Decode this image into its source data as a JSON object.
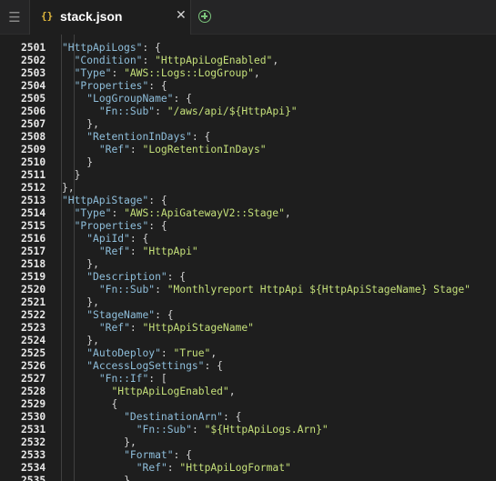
{
  "tab": {
    "icon": "{}",
    "title": "stack.json"
  },
  "lines": [
    {
      "n": "2501",
      "t": "    \"HttpApiLogs\": {"
    },
    {
      "n": "2502",
      "t": "      \"Condition\": \"HttpApiLogEnabled\","
    },
    {
      "n": "2503",
      "t": "      \"Type\": \"AWS::Logs::LogGroup\","
    },
    {
      "n": "2504",
      "t": "      \"Properties\": {"
    },
    {
      "n": "2505",
      "t": "        \"LogGroupName\": {"
    },
    {
      "n": "2506",
      "t": "          \"Fn::Sub\": \"/aws/api/${HttpApi}\""
    },
    {
      "n": "2507",
      "t": "        },"
    },
    {
      "n": "2508",
      "t": "        \"RetentionInDays\": {"
    },
    {
      "n": "2509",
      "t": "          \"Ref\": \"LogRetentionInDays\""
    },
    {
      "n": "2510",
      "t": "        }"
    },
    {
      "n": "2511",
      "t": "      }"
    },
    {
      "n": "2512",
      "t": "    },"
    },
    {
      "n": "2513",
      "t": "    \"HttpApiStage\": {"
    },
    {
      "n": "2514",
      "t": "      \"Type\": \"AWS::ApiGatewayV2::Stage\","
    },
    {
      "n": "2515",
      "t": "      \"Properties\": {"
    },
    {
      "n": "2516",
      "t": "        \"ApiId\": {"
    },
    {
      "n": "2517",
      "t": "          \"Ref\": \"HttpApi\""
    },
    {
      "n": "2518",
      "t": "        },"
    },
    {
      "n": "2519",
      "t": "        \"Description\": {"
    },
    {
      "n": "2520",
      "t": "          \"Fn::Sub\": \"Monthlyreport HttpApi ${HttpApiStageName} Stage\""
    },
    {
      "n": "2521",
      "t": "        },"
    },
    {
      "n": "2522",
      "t": "        \"StageName\": {"
    },
    {
      "n": "2523",
      "t": "          \"Ref\": \"HttpApiStageName\""
    },
    {
      "n": "2524",
      "t": "        },"
    },
    {
      "n": "2525",
      "t": "        \"AutoDeploy\": \"True\","
    },
    {
      "n": "2526",
      "t": "        \"AccessLogSettings\": {"
    },
    {
      "n": "2527",
      "t": "          \"Fn::If\": ["
    },
    {
      "n": "2528",
      "t": "            \"HttpApiLogEnabled\","
    },
    {
      "n": "2529",
      "t": "            {"
    },
    {
      "n": "2530",
      "t": "              \"DestinationArn\": {"
    },
    {
      "n": "2531",
      "t": "                \"Fn::Sub\": \"${HttpApiLogs.Arn}\""
    },
    {
      "n": "2532",
      "t": "              },"
    },
    {
      "n": "2533",
      "t": "              \"Format\": {"
    },
    {
      "n": "2534",
      "t": "                \"Ref\": \"HttpApiLogFormat\""
    },
    {
      "n": "2535",
      "t": "              }"
    }
  ]
}
